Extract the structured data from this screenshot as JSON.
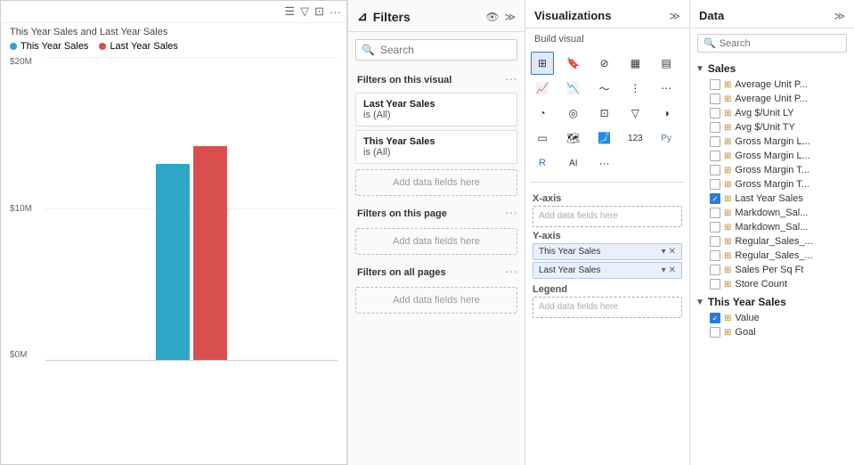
{
  "chart": {
    "title": "This Year Sales and Last Year Sales",
    "legend": [
      {
        "label": "This Year Sales",
        "color": "#2DA6C8"
      },
      {
        "label": "Last Year Sales",
        "color": "#D94F4F"
      }
    ],
    "yAxis": [
      "$20M",
      "$10M",
      "$0M"
    ],
    "bars": [
      {
        "thisYear": 220,
        "lastYear": 240
      }
    ]
  },
  "filters": {
    "title": "Filters",
    "searchPlaceholder": "Search",
    "sections": [
      {
        "label": "Filters on this visual",
        "items": [
          {
            "name": "Last Year Sales",
            "value": "is (All)"
          },
          {
            "name": "This Year Sales",
            "value": "is (All)"
          }
        ],
        "addLabel": "Add data fields here"
      },
      {
        "label": "Filters on this page",
        "items": [],
        "addLabel": "Add data fields here"
      },
      {
        "label": "Filters on all pages",
        "items": [],
        "addLabel": "Add data fields here"
      }
    ]
  },
  "visualizations": {
    "title": "Visualizations",
    "buildLabel": "Build visual",
    "fields": [
      {
        "label": "X-axis",
        "chips": [],
        "placeholder": "Add data fields here"
      },
      {
        "label": "Y-axis",
        "chips": [
          {
            "text": "This Year Sales",
            "active": true
          },
          {
            "text": "Last Year Sales",
            "active": true
          }
        ]
      },
      {
        "label": "Legend",
        "chips": [],
        "placeholder": "Add data fields here"
      }
    ]
  },
  "data": {
    "title": "Data",
    "searchPlaceholder": "Search",
    "groups": [
      {
        "label": "Sales",
        "expanded": true,
        "items": [
          {
            "text": "Average Unit P...",
            "checked": false
          },
          {
            "text": "Average Unit P...",
            "checked": false
          },
          {
            "text": "Avg $/Unit LY",
            "checked": false
          },
          {
            "text": "Avg $/Unit TY",
            "checked": false
          },
          {
            "text": "Gross Margin L...",
            "checked": false
          },
          {
            "text": "Gross Margin L...",
            "checked": false
          },
          {
            "text": "Gross Margin T...",
            "checked": false
          },
          {
            "text": "Gross Margin T...",
            "checked": false
          },
          {
            "text": "Last Year Sales",
            "checked": true
          },
          {
            "text": "Markdown_Sal...",
            "checked": false
          },
          {
            "text": "Markdown_Sal...",
            "checked": false
          },
          {
            "text": "Regular_Sales_...",
            "checked": false
          },
          {
            "text": "Regular_Sales_...",
            "checked": false
          },
          {
            "text": "Sales Per Sq Ft",
            "checked": false
          },
          {
            "text": "Store Count",
            "checked": false
          }
        ]
      },
      {
        "label": "This Year Sales",
        "expanded": true,
        "items": [
          {
            "text": "Value",
            "checked": true
          },
          {
            "text": "Goal",
            "checked": false
          }
        ]
      }
    ]
  }
}
